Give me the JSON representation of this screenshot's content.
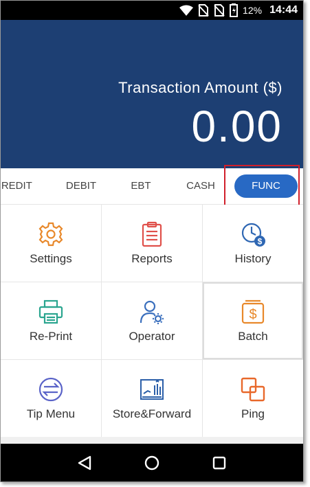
{
  "status_bar": {
    "battery_percent": "12%",
    "time": "14:44",
    "icons": [
      "wifi-icon",
      "no-sim-icon",
      "no-sim-icon",
      "battery-low-icon"
    ]
  },
  "hero": {
    "label": "Transaction Amount ($)",
    "amount": "0.00",
    "background_color": "#1d3f73"
  },
  "tabs": [
    {
      "label": "CREDIT"
    },
    {
      "label": "DEBIT"
    },
    {
      "label": "EBT"
    },
    {
      "label": "CASH"
    },
    {
      "label": "FUNC",
      "selected": true
    }
  ],
  "accent_color": "#2869c4",
  "highlight_color": "#d11f2a",
  "functions": [
    {
      "label": "Settings",
      "icon": "gear-icon",
      "color": "#e8882a"
    },
    {
      "label": "Reports",
      "icon": "clipboard-icon",
      "color": "#e0504a"
    },
    {
      "label": "History",
      "icon": "clock-dollar-icon",
      "color": "#2f67b3"
    },
    {
      "label": "Re-Print",
      "icon": "printer-icon",
      "color": "#2aa58f"
    },
    {
      "label": "Operator",
      "icon": "user-gear-icon",
      "color": "#3a6fbd"
    },
    {
      "label": "Batch",
      "icon": "dollar-box-icon",
      "color": "#e8882a"
    },
    {
      "label": "Tip Menu",
      "icon": "arrows-exchange-icon",
      "color": "#5a63c8"
    },
    {
      "label": "Store&Forward",
      "icon": "chart-forward-icon",
      "color": "#2a5ea8"
    },
    {
      "label": "Ping",
      "icon": "overlap-squares-icon",
      "color": "#e8682a"
    }
  ],
  "nav": [
    "back-icon",
    "home-icon",
    "recent-apps-icon"
  ]
}
